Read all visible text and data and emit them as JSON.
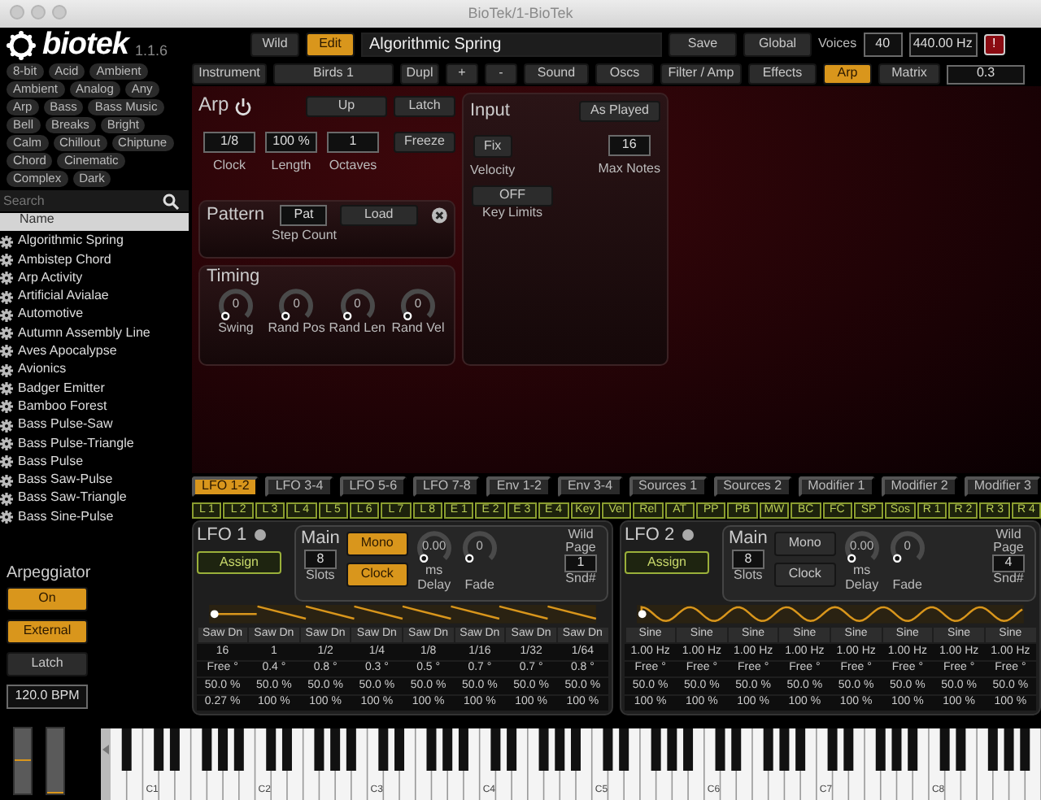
{
  "window": {
    "title": "BioTek/1-BioTek"
  },
  "header": {
    "logo": "biotek",
    "version": "1.1.6",
    "modes": [
      {
        "label": "Wild",
        "selected": false
      },
      {
        "label": "Edit",
        "selected": true
      }
    ],
    "patch_name": "Algorithmic Spring",
    "buttons": [
      "Save",
      "Global"
    ],
    "voices_label": "Voices",
    "voices": "40",
    "tuning": "440.00 Hz",
    "alert": "!"
  },
  "sidebar": {
    "tags": [
      "8-bit",
      "Acid",
      "Ambient",
      "Ambient",
      "Analog",
      "Any",
      "Arp",
      "Bass",
      "Bass Music",
      "Bell",
      "Breaks",
      "Bright",
      "Calm",
      "Chillout",
      "Chiptune",
      "Chord",
      "Cinematic",
      "Complex",
      "Dark"
    ],
    "search": {
      "placeholder": "Search"
    },
    "list_header": "Name",
    "patches": [
      "Algorithmic Spring",
      "Ambistep Chord",
      "Arp Activity",
      "Artificial Avialae",
      "Automotive",
      "Autumn Assembly Line",
      "Aves Apocalypse",
      "Avionics",
      "Badger Emitter",
      "Bamboo Forest",
      "Bass Pulse-Saw",
      "Bass Pulse-Triangle",
      "Bass Pulse",
      "Bass Saw-Pulse",
      "Bass Saw-Triangle",
      "Bass Sine-Pulse"
    ],
    "arpeggiator": {
      "title": "Arpeggiator",
      "toggles": [
        {
          "label": "On",
          "selected": true
        },
        {
          "label": "External",
          "selected": true
        },
        {
          "label": "Latch",
          "selected": false
        }
      ],
      "tempo": "120.0 BPM"
    }
  },
  "section_bar": {
    "instrument": "Instrument",
    "preset": "Birds 1",
    "buttons": [
      "Dupl",
      "+",
      "-"
    ],
    "tabs": [
      {
        "label": "Sound",
        "selected": false
      },
      {
        "label": "Oscs",
        "selected": false
      },
      {
        "label": "Filter / Amp",
        "selected": false
      },
      {
        "label": "Effects",
        "selected": false
      },
      {
        "label": "Arp",
        "selected": true
      },
      {
        "label": "Matrix",
        "selected": false
      }
    ],
    "value": "0.3"
  },
  "arp": {
    "title": "Arp",
    "direction": "Up",
    "latch": "Latch",
    "params": [
      {
        "value": "1/8",
        "label": "Clock"
      },
      {
        "value": "100 %",
        "label": "Length"
      },
      {
        "value": "1",
        "label": "Octaves"
      }
    ],
    "freeze": "Freeze",
    "pattern": {
      "title": "Pattern",
      "field": "Pat",
      "load": "Load",
      "caption": "Step Count"
    },
    "timing": {
      "title": "Timing",
      "knobs": [
        {
          "value": "0",
          "label": "Swing"
        },
        {
          "value": "0",
          "label": "Rand Pos"
        },
        {
          "value": "0",
          "label": "Rand Len"
        },
        {
          "value": "0",
          "label": "Rand Vel"
        }
      ]
    },
    "input": {
      "title": "Input",
      "mode": "As Played",
      "velocity": {
        "value": "Fix",
        "label": "Velocity"
      },
      "max_notes": {
        "value": "16",
        "label": "Max Notes"
      },
      "key_limits": {
        "value": "OFF",
        "label": "Key Limits"
      }
    }
  },
  "mod_tabs": [
    {
      "label": "LFO 1-2",
      "selected": true
    },
    {
      "label": "LFO 3-4",
      "selected": false
    },
    {
      "label": "LFO 5-6",
      "selected": false
    },
    {
      "label": "LFO 7-8",
      "selected": false
    },
    {
      "label": "Env 1-2",
      "selected": false
    },
    {
      "label": "Env 3-4",
      "selected": false
    },
    {
      "label": "Sources 1",
      "selected": false
    },
    {
      "label": "Sources 2",
      "selected": false
    },
    {
      "label": "Modifier 1",
      "selected": false
    },
    {
      "label": "Modifier 2",
      "selected": false
    },
    {
      "label": "Modifier 3",
      "selected": false
    }
  ],
  "mod_sources": [
    "L 1",
    "L 2",
    "L 3",
    "L 4",
    "L 5",
    "L 6",
    "L 7",
    "L 8",
    "E 1",
    "E 2",
    "E 3",
    "E 4",
    "Key",
    "Vel",
    "Rel",
    "AT",
    "PP",
    "PB",
    "MW",
    "BC",
    "FC",
    "SP",
    "Sos",
    "R 1",
    "R 2",
    "R 3",
    "R 4"
  ],
  "lfos": [
    {
      "title": "LFO 1",
      "assign": "Assign",
      "main": "Main",
      "mono": {
        "label": "Mono",
        "on": true
      },
      "clock": {
        "label": "Clock",
        "on": true
      },
      "slots": {
        "value": "8",
        "label": "Slots"
      },
      "delay": {
        "value": "0.00",
        "unit": "ms",
        "label": "Delay"
      },
      "fade": {
        "value": "0",
        "label": "Fade"
      },
      "wild_page": "Wild Page",
      "snd": {
        "value": "1",
        "label": "Snd#"
      },
      "kind": "saw",
      "rows": [
        [
          "Saw Dn",
          "Saw Dn",
          "Saw Dn",
          "Saw Dn",
          "Saw Dn",
          "Saw Dn",
          "Saw Dn",
          "Saw Dn"
        ],
        [
          "16",
          "1",
          "1/2",
          "1/4",
          "1/8",
          "1/16",
          "1/32",
          "1/64"
        ],
        [
          "Free °",
          "0.4 °",
          "0.8 °",
          "0.3 °",
          "0.5 °",
          "0.7 °",
          "0.7 °",
          "0.8 °"
        ],
        [
          "50.0 %",
          "50.0 %",
          "50.0 %",
          "50.0 %",
          "50.0 %",
          "50.0 %",
          "50.0 %",
          "50.0 %"
        ],
        [
          "0.27 %",
          "100 %",
          "100 %",
          "100 %",
          "100 %",
          "100 %",
          "100 %",
          "100 %"
        ]
      ]
    },
    {
      "title": "LFO 2",
      "assign": "Assign",
      "main": "Main",
      "mono": {
        "label": "Mono",
        "on": false
      },
      "clock": {
        "label": "Clock",
        "on": false
      },
      "slots": {
        "value": "8",
        "label": "Slots"
      },
      "delay": {
        "value": "0.00",
        "unit": "ms",
        "label": "Delay"
      },
      "fade": {
        "value": "0",
        "label": "Fade"
      },
      "wild_page": "Wild Page",
      "snd": {
        "value": "4",
        "label": "Snd#"
      },
      "kind": "sine",
      "rows": [
        [
          "Sine",
          "Sine",
          "Sine",
          "Sine",
          "Sine",
          "Sine",
          "Sine",
          "Sine"
        ],
        [
          "1.00 Hz",
          "1.00 Hz",
          "1.00 Hz",
          "1.00 Hz",
          "1.00 Hz",
          "1.00 Hz",
          "1.00 Hz",
          "1.00 Hz"
        ],
        [
          "Free °",
          "Free °",
          "Free °",
          "Free °",
          "Free °",
          "Free °",
          "Free °",
          "Free °"
        ],
        [
          "50.0 %",
          "50.0 %",
          "50.0 %",
          "50.0 %",
          "50.0 %",
          "50.0 %",
          "50.0 %",
          "50.0 %"
        ],
        [
          "100 %",
          "100 %",
          "100 %",
          "100 %",
          "100 %",
          "100 %",
          "100 %",
          "100 %"
        ]
      ]
    }
  ],
  "keyboard": {
    "pitch_wheel": {
      "level": 0.5
    },
    "mod_wheel": {
      "level": 0
    },
    "octave_labels": [
      "C1",
      "C2",
      "C3",
      "C4",
      "C5",
      "C6",
      "C7",
      "C8"
    ]
  }
}
